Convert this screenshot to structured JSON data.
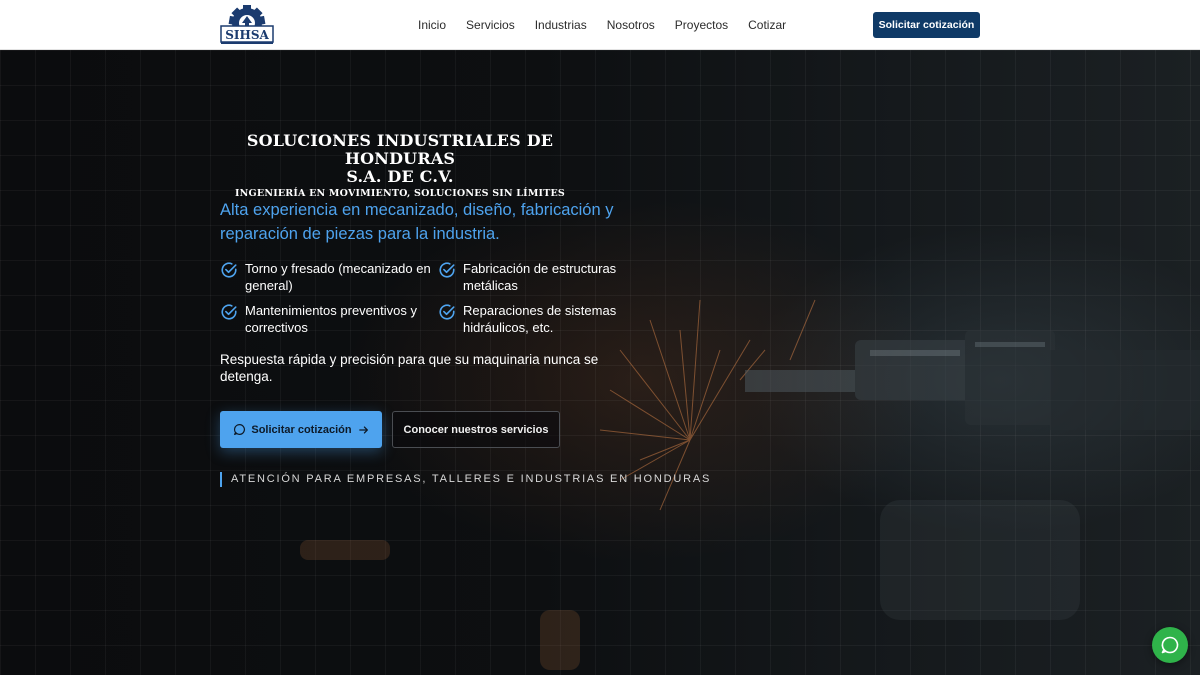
{
  "header": {
    "logo_text": "SIHSA",
    "nav": [
      {
        "label": "Inicio"
      },
      {
        "label": "Servicios"
      },
      {
        "label": "Industrias"
      },
      {
        "label": "Nosotros"
      },
      {
        "label": "Proyectos"
      },
      {
        "label": "Cotizar"
      }
    ],
    "cta_label": "Solicitar cotización"
  },
  "hero": {
    "company_line1": "SOLUCIONES INDUSTRIALES DE HONDURAS",
    "company_line2": "S.A. DE C.V.",
    "tagline": "INGENIERÍA EN MOVIMIENTO, SOLUCIONES SIN LÍMITES",
    "lead": "Alta experiencia en mecanizado, diseño, fabricación y reparación de piezas para la industria.",
    "features": [
      {
        "text": "Torno y fresado (mecanizado en general)",
        "icon": "check-circle-icon"
      },
      {
        "text": "Fabricación de estructuras metálicas",
        "icon": "check-circle-icon"
      },
      {
        "text": "Mantenimientos preventivos y correctivos",
        "icon": "check-circle-icon"
      },
      {
        "text": "Reparaciones de sistemas hidráulicos, etc.",
        "icon": "check-circle-icon"
      }
    ],
    "response_text": "Respuesta rápida y precisión para que su maquinaria nunca se detenga.",
    "primary_cta": "Solicitar cotización",
    "secondary_cta": "Conocer nuestros servicios",
    "attention": "ATENCIÓN PARA EMPRESAS, TALLERES E INDUSTRIAS EN HONDURAS"
  },
  "colors": {
    "accent": "#4ea3ee",
    "header_cta": "#0f3a67",
    "chat_fab": "#2fb34a",
    "logo_navy": "#1b3b6f"
  },
  "chat_fab": {
    "icon": "chat-bubble-icon"
  }
}
